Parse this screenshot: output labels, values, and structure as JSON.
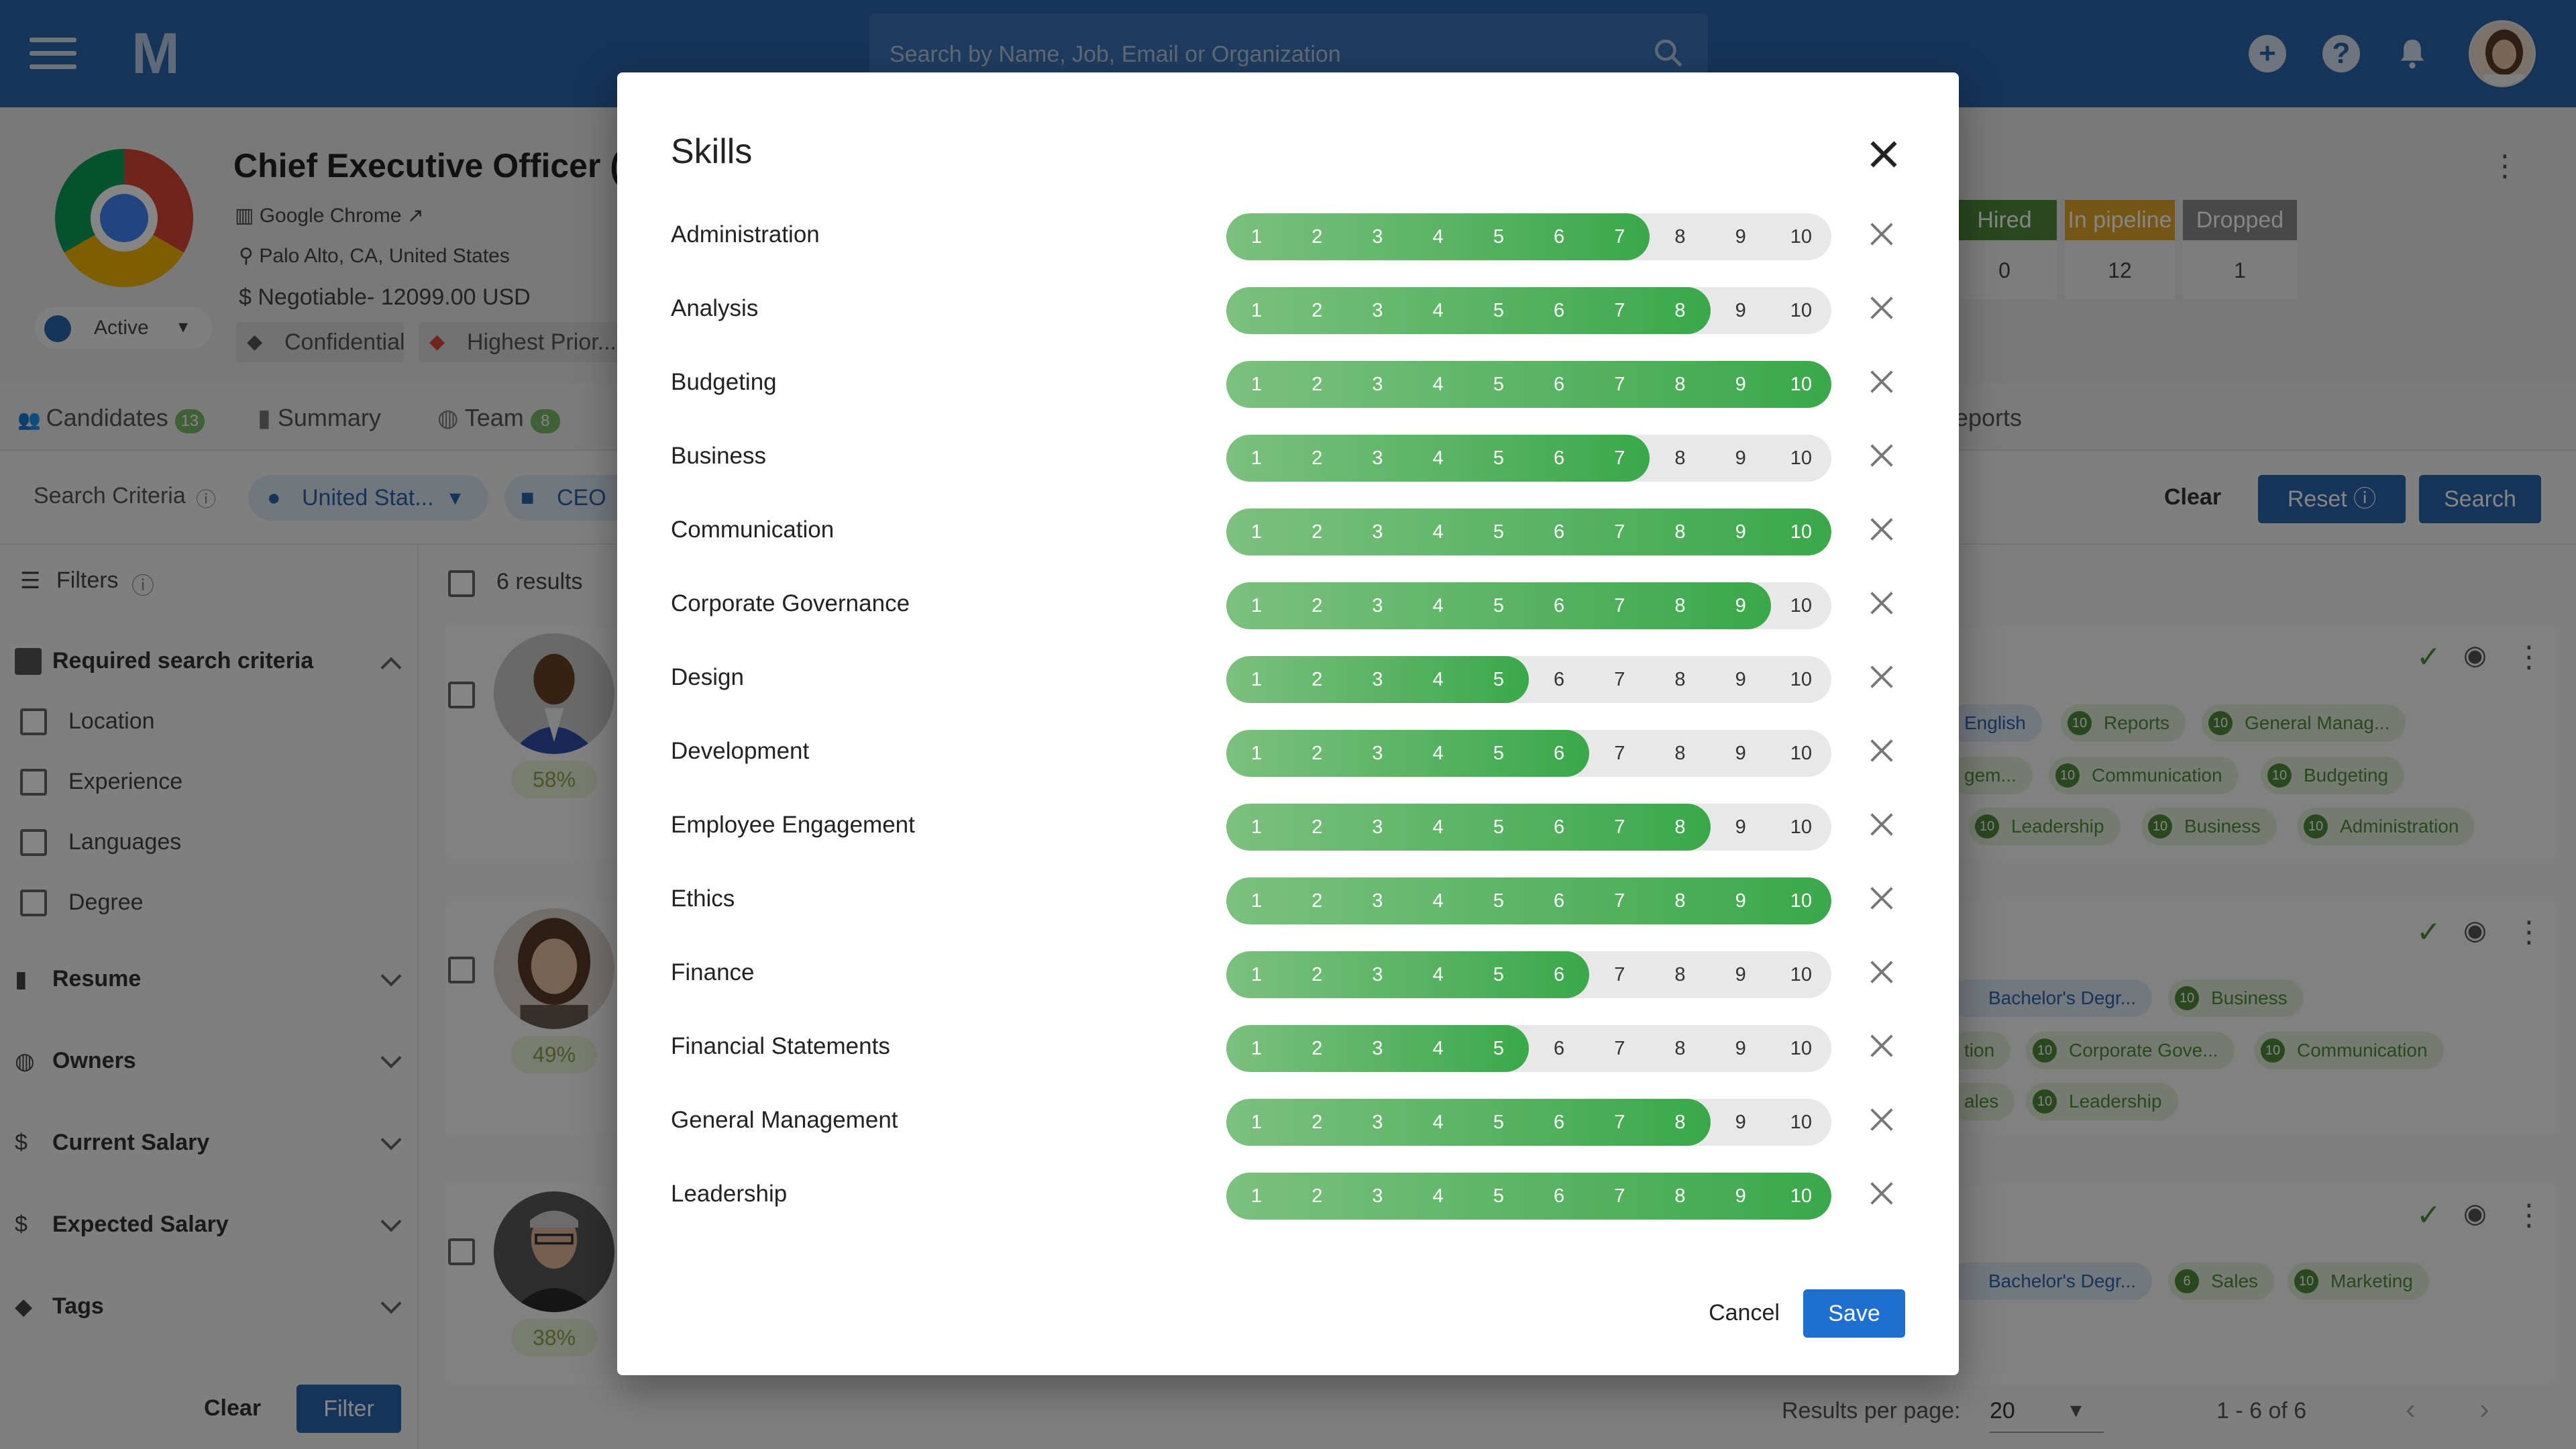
{
  "app": {
    "search_placeholder": "Search by Name, Job, Email or Organization",
    "logo": "M"
  },
  "job": {
    "title": "Chief Executive Officer (C",
    "company": "Google Chrome",
    "location": "Palo Alto, CA, United States",
    "salary": "Negotiable- 12099.00 USD",
    "status": "Active",
    "chips": [
      "Confidential",
      "Highest Prior..."
    ],
    "pipeline": [
      {
        "label": "Hired",
        "value": "0",
        "color": "#4f8a3d"
      },
      {
        "label": "In pipeline",
        "value": "12",
        "color": "#e0a52a"
      },
      {
        "label": "Dropped",
        "value": "1",
        "color": "#8a8a8a"
      }
    ]
  },
  "tabs": [
    {
      "label": "Candidates",
      "badge": "13"
    },
    {
      "label": "Summary",
      "badge": ""
    },
    {
      "label": "Team",
      "badge": "8"
    },
    {
      "label": "eports",
      "badge": ""
    }
  ],
  "criteria": {
    "label": "Search Criteria",
    "pills": [
      "United Stat...",
      "CEO"
    ],
    "clear": "Clear",
    "reset": "Reset",
    "search": "Search"
  },
  "filters": {
    "title": "Filters",
    "required": "Required search criteria",
    "options": [
      "Location",
      "Experience",
      "Languages",
      "Degree"
    ],
    "sections": [
      "Resume",
      "Owners",
      "Current Salary",
      "Expected Salary",
      "Tags"
    ],
    "clear": "Clear",
    "filter": "Filter"
  },
  "results": {
    "count": "6 results",
    "per_page_label": "Results per page:",
    "per_page": "20",
    "range": "1 - 6 of 6",
    "candidates": [
      {
        "match": "58%",
        "tags": [
          [
            {
              "n": "",
              "t": "English",
              "blue": true
            },
            {
              "n": "10",
              "t": "Reports"
            },
            {
              "n": "10",
              "t": "General Manag..."
            }
          ],
          [
            {
              "n": "",
              "t": "gem...",
              "plain": true
            },
            {
              "n": "10",
              "t": "Communication"
            },
            {
              "n": "10",
              "t": "Budgeting"
            }
          ],
          [
            {
              "n": "10",
              "t": "Leadership"
            },
            {
              "n": "10",
              "t": "Business"
            },
            {
              "n": "10",
              "t": "Administration"
            }
          ]
        ]
      },
      {
        "match": "49%",
        "tags": [
          [
            {
              "n": "",
              "t": "Bachelor's Degr...",
              "blue": true
            },
            {
              "n": "10",
              "t": "Business"
            }
          ],
          [
            {
              "n": "",
              "t": "tion",
              "plain": true
            },
            {
              "n": "10",
              "t": "Corporate Gove..."
            },
            {
              "n": "10",
              "t": "Communication"
            }
          ],
          [
            {
              "n": "",
              "t": "ales",
              "plain": true
            },
            {
              "n": "10",
              "t": "Leadership"
            }
          ]
        ]
      },
      {
        "match": "38%",
        "tags": [
          [
            {
              "n": "",
              "t": "Bachelor's Degr...",
              "blue": true
            },
            {
              "n": "6",
              "t": "Sales"
            },
            {
              "n": "10",
              "t": "Marketing"
            }
          ]
        ]
      }
    ]
  },
  "modal": {
    "title": "Skills",
    "cancel": "Cancel",
    "save": "Save",
    "scale": [
      "1",
      "2",
      "3",
      "4",
      "5",
      "6",
      "7",
      "8",
      "9",
      "10"
    ],
    "skills": [
      {
        "name": "Administration",
        "level": 7
      },
      {
        "name": "Analysis",
        "level": 8
      },
      {
        "name": "Budgeting",
        "level": 10
      },
      {
        "name": "Business",
        "level": 7
      },
      {
        "name": "Communication",
        "level": 10
      },
      {
        "name": "Corporate Governance",
        "level": 9
      },
      {
        "name": "Design",
        "level": 5
      },
      {
        "name": "Development",
        "level": 6
      },
      {
        "name": "Employee Engagement",
        "level": 8
      },
      {
        "name": "Ethics",
        "level": 10
      },
      {
        "name": "Finance",
        "level": 6
      },
      {
        "name": "Financial Statements",
        "level": 5
      },
      {
        "name": "General Management",
        "level": 8
      },
      {
        "name": "Leadership",
        "level": 10
      }
    ],
    "colors": {
      "fill_start": "#7cc07f",
      "fill_end": "#3aa84a",
      "track": "#e8e8e8"
    }
  }
}
